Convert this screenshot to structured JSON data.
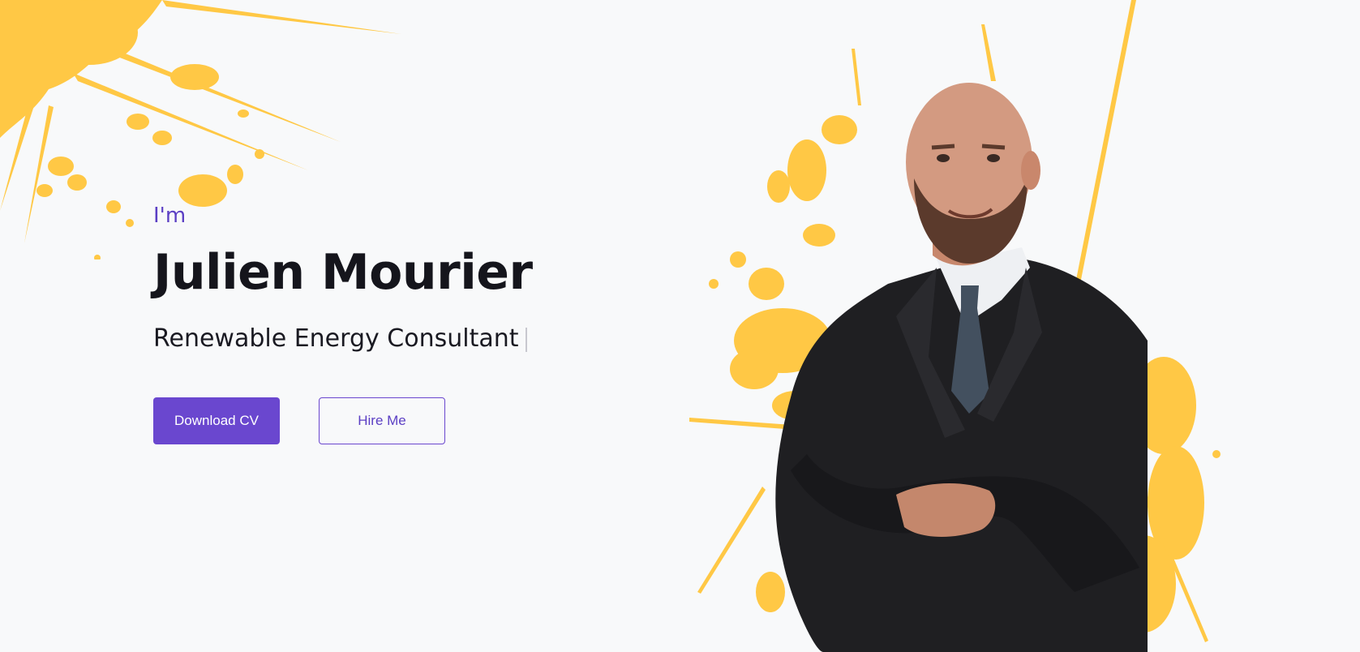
{
  "hero": {
    "greeting": "I'm",
    "name": "Julien Mourier",
    "role": "Renewable Energy Consultant",
    "buttons": {
      "download_label": "Download CV",
      "hire_label": "Hire Me"
    }
  },
  "colors": {
    "background": "#f8f9fa",
    "accent": "#6a47cf",
    "splash": "#ffc845",
    "heading": "#15151c"
  }
}
